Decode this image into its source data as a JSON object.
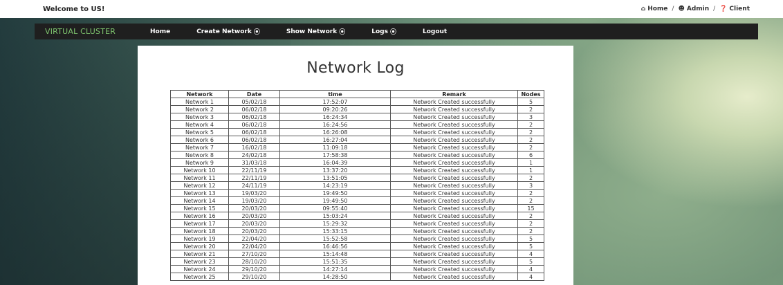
{
  "header": {
    "welcome": "Welcome to US!",
    "links": [
      {
        "icon": "home-icon",
        "glyph": "⌂",
        "label": "Home"
      },
      {
        "icon": "users-icon",
        "glyph": "☻",
        "label": "Admin"
      },
      {
        "icon": "question-icon",
        "glyph": "❓",
        "label": "Client"
      }
    ],
    "separator": "/"
  },
  "navbar": {
    "brand": "VIRTUAL CLUSTER",
    "items": [
      {
        "label": "Home",
        "has_icon": false
      },
      {
        "label": "Create Network",
        "has_icon": true
      },
      {
        "label": "Show Network",
        "has_icon": true
      },
      {
        "label": "Logs",
        "has_icon": true
      },
      {
        "label": "Logout",
        "has_icon": false
      }
    ],
    "dropdown_glyph": "⦿"
  },
  "main": {
    "title": "Network Log",
    "columns": [
      "Network",
      "Date",
      "time",
      "Remark",
      "Nodes"
    ],
    "rows": [
      [
        "Network 1",
        "05/02/18",
        "17:52:07",
        "Network Created successfully",
        "5"
      ],
      [
        "Network 2",
        "06/02/18",
        "09:20:26",
        "Network Created successfully",
        "2"
      ],
      [
        "Network 3",
        "06/02/18",
        "16:24:34",
        "Network Created successfully",
        "3"
      ],
      [
        "Network 4",
        "06/02/18",
        "16:24:56",
        "Network Created successfully",
        "2"
      ],
      [
        "Network 5",
        "06/02/18",
        "16:26:08",
        "Network Created successfully",
        "2"
      ],
      [
        "Network 6",
        "06/02/18",
        "16:27:04",
        "Network Created successfully",
        "2"
      ],
      [
        "Network 7",
        "16/02/18",
        "11:09:18",
        "Network Created successfully",
        "2"
      ],
      [
        "Network 8",
        "24/02/18",
        "17:58:38",
        "Network Created successfully",
        "6"
      ],
      [
        "Network 9",
        "31/03/18",
        "16:04:39",
        "Network Created successfully",
        "1"
      ],
      [
        "Network 10",
        "22/11/19",
        "13:37:20",
        "Network Created successfully",
        "1"
      ],
      [
        "Network 11",
        "22/11/19",
        "13:51:05",
        "Network Created successfully",
        "2"
      ],
      [
        "Network 12",
        "24/11/19",
        "14:23:19",
        "Network Created successfully",
        "3"
      ],
      [
        "Network 13",
        "19/03/20",
        "19:49:50",
        "Network Created successfully",
        "2"
      ],
      [
        "Network 14",
        "19/03/20",
        "19:49:50",
        "Network Created successfully",
        "2"
      ],
      [
        "Network 15",
        "20/03/20",
        "09:55:40",
        "Network Created successfully",
        "15"
      ],
      [
        "Network 16",
        "20/03/20",
        "15:03:24",
        "Network Created successfully",
        "2"
      ],
      [
        "Network 17",
        "20/03/20",
        "15:29:32",
        "Network Created successfully",
        "2"
      ],
      [
        "Network 18",
        "20/03/20",
        "15:33:15",
        "Network Created successfully",
        "2"
      ],
      [
        "Network 19",
        "22/04/20",
        "15:52:58",
        "Network Created successfully",
        "5"
      ],
      [
        "Network 20",
        "22/04/20",
        "16:46:56",
        "Network Created successfully",
        "5"
      ],
      [
        "Network 21",
        "27/10/20",
        "15:14:48",
        "Network Created successfully",
        "4"
      ],
      [
        "Network 23",
        "28/10/20",
        "15:51:35",
        "Network Created successfully",
        "5"
      ],
      [
        "Network 24",
        "29/10/20",
        "14:27:14",
        "Network Created successfully",
        "4"
      ],
      [
        "Network 25",
        "29/10/20",
        "14:28:50",
        "Network Created successfully",
        "4"
      ]
    ]
  },
  "colors": {
    "brand": "#7ec46e",
    "navbar_bg": "#1f1f1f",
    "panel_bg": "#ffffff"
  }
}
